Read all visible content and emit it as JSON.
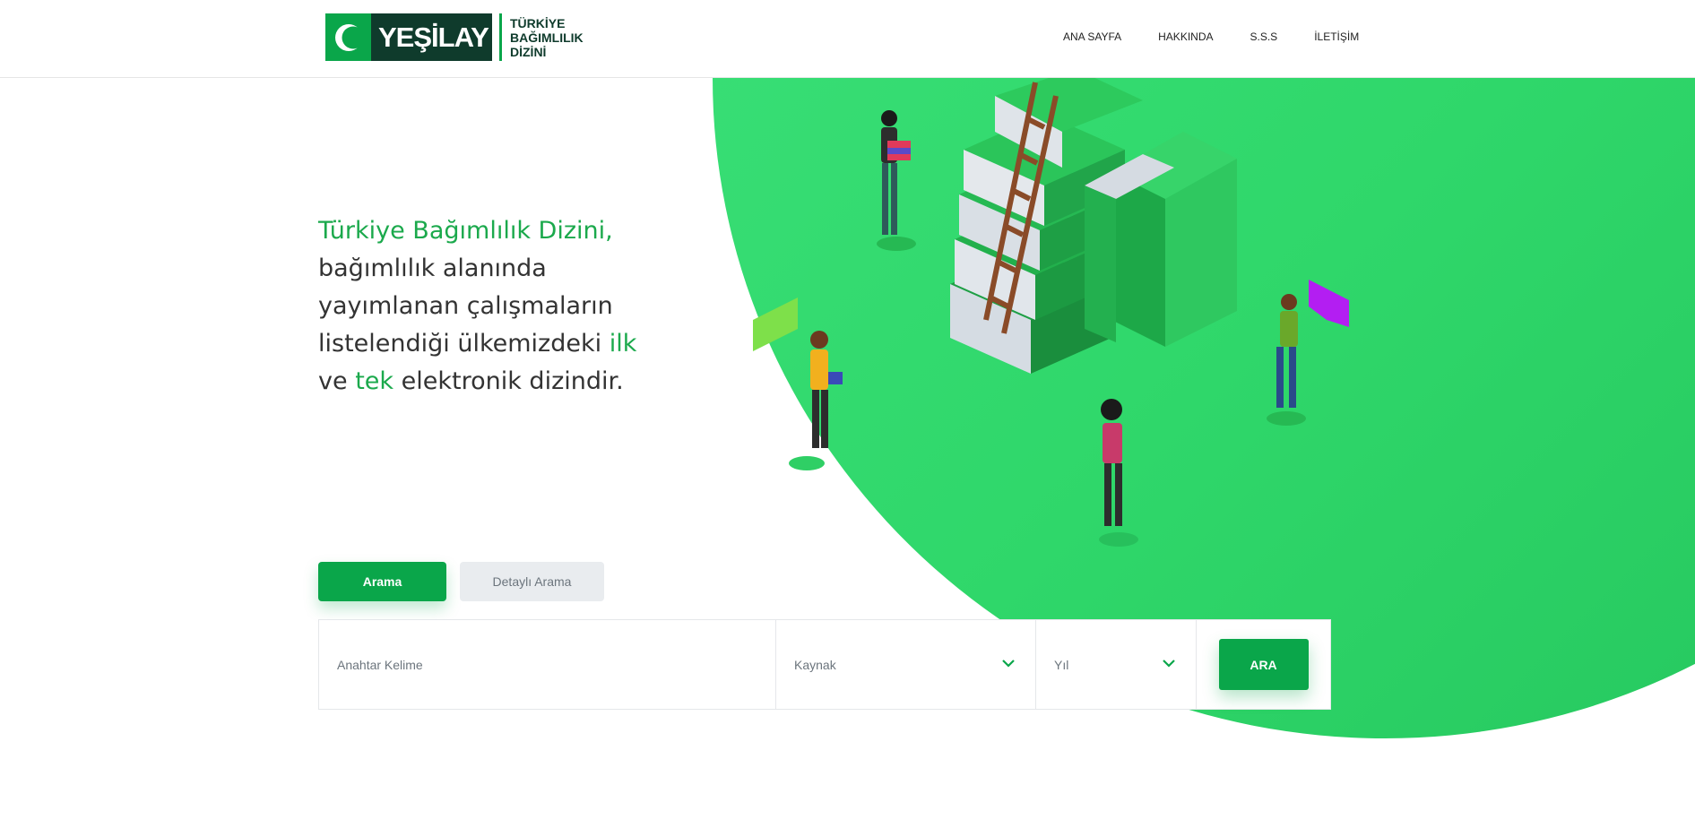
{
  "header": {
    "logo": {
      "brand": "YEŞİLAY",
      "subtitle_line1": "TÜRKİYE",
      "subtitle_line2": "BAĞIMLILIK",
      "subtitle_line3": "DİZİNİ"
    },
    "nav": [
      {
        "label": "ANA SAYFA"
      },
      {
        "label": "HAKKINDA"
      },
      {
        "label": "S.S.S"
      },
      {
        "label": "İLETİŞİM"
      }
    ]
  },
  "hero": {
    "headline_part1": "Türkiye Bağımlılık Dizini,",
    "headline_part2": "bağımlılık alanında yayımlanan çalışmaların listelendiği ülkemizdeki",
    "headline_word_ilk": "ilk",
    "headline_word_ve": "ve",
    "headline_word_tek": "tek",
    "headline_part3": "elektronik dizindir."
  },
  "tabs": {
    "search": "Arama",
    "advanced": "Detaylı Arama"
  },
  "search": {
    "keyword_placeholder": "Anahtar Kelime",
    "source_label": "Kaynak",
    "year_label": "Yıl",
    "button_label": "ARA"
  },
  "colors": {
    "brand_green": "#0aa64a",
    "brand_dark": "#0f3b2c",
    "hero_green": "#2fd76a",
    "headline_accent": "#1ba94c"
  }
}
